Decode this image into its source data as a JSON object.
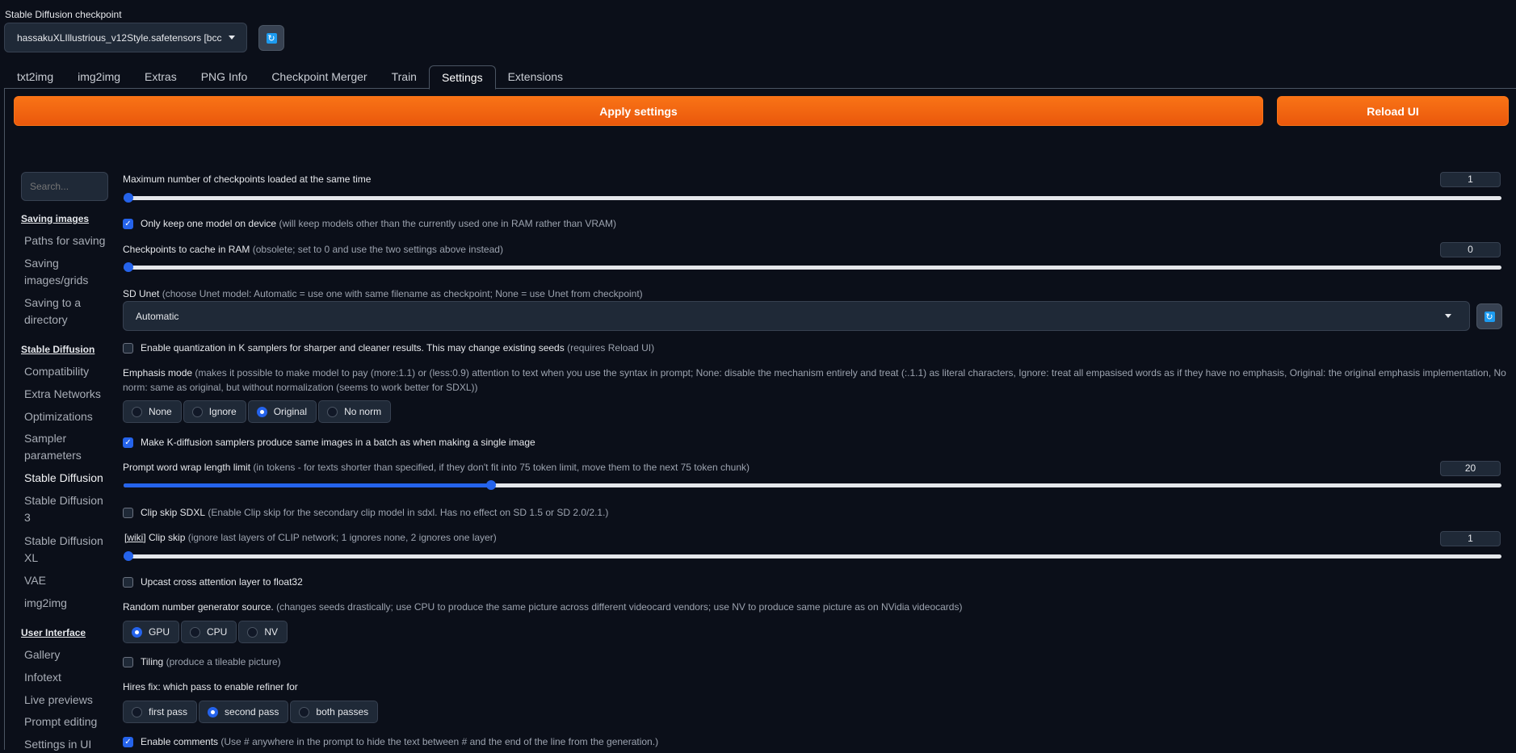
{
  "checkpoint": {
    "label": "Stable Diffusion checkpoint",
    "value": "hassakuXLIllustrious_v12Style.safetensors [bcc:"
  },
  "tabs": [
    "txt2img",
    "img2img",
    "Extras",
    "PNG Info",
    "Checkpoint Merger",
    "Train",
    "Settings",
    "Extensions"
  ],
  "active_tab": "Settings",
  "buttons": {
    "apply": "Apply settings",
    "reload": "Reload UI"
  },
  "sidebar": {
    "search_placeholder": "Search...",
    "sections": [
      {
        "title": "Saving images",
        "items": [
          "Paths for saving",
          "Saving images/grids",
          "Saving to a directory"
        ]
      },
      {
        "title": "Stable Diffusion",
        "items": [
          "Compatibility",
          "Extra Networks",
          "Optimizations",
          "Sampler parameters",
          "Stable Diffusion",
          "Stable Diffusion 3",
          "Stable Diffusion XL",
          "VAE",
          "img2img"
        ]
      },
      {
        "title": "User Interface",
        "items": [
          "Gallery",
          "Infotext",
          "Live previews",
          "Prompt editing",
          "Settings in UI"
        ]
      }
    ],
    "active_item": "Stable Diffusion"
  },
  "settings": {
    "max_checkpoints": {
      "label": "Maximum number of checkpoints loaded at the same time",
      "value": "1",
      "level": 0
    },
    "one_model": {
      "label": "Only keep one model on device",
      "hint": "(will keep models other than the currently used one in RAM rather than VRAM)",
      "checked": true
    },
    "cache_ram": {
      "label": "Checkpoints to cache in RAM",
      "hint": "(obsolete; set to 0 and use the two settings above instead)",
      "value": "0",
      "level": 0
    },
    "sd_unet": {
      "label": "SD Unet",
      "hint": "(choose Unet model: Automatic = use one with same filename as checkpoint; None = use Unet from checkpoint)",
      "value": "Automatic"
    },
    "quantization": {
      "label": "Enable quantization in K samplers for sharper and cleaner results. This may change existing seeds",
      "hint": "(requires Reload UI)",
      "checked": false
    },
    "emphasis": {
      "label": "Emphasis mode",
      "hint_line1": "(makes it possible to make model to pay (more:1.1) or (less:0.9) attention to text when you use the syntax in prompt; None: disable the mechanism entirely and treat (:.1.1) as literal characters, Ignore: treat all empasised words as if they have no emphasis, Original: the original emphasis implementation, No",
      "hint_line2": "norm: same as original, but without normalization (seems to work better for SDXL))",
      "options": [
        "None",
        "Ignore",
        "Original",
        "No norm"
      ],
      "selected": "Original"
    },
    "batch_same": {
      "label": "Make K-diffusion samplers produce same images in a batch as when making a single image",
      "checked": true
    },
    "wrap_limit": {
      "label": "Prompt word wrap length limit",
      "hint": "(in tokens - for texts shorter than specified, if they don't fit into 75 token limit, move them to the next 75 token chunk)",
      "value": "20",
      "level": 0.2667
    },
    "clip_skip_sdxl": {
      "label": "Clip skip SDXL",
      "hint": "(Enable Clip skip for the secondary clip model in sdxl. Has no effect on SD 1.5 or SD 2.0/2.1.)",
      "checked": false
    },
    "clip_skip": {
      "wiki": "[wiki]",
      "label": "Clip skip",
      "hint": "(ignore last layers of CLIP network; 1 ignores none, 2 ignores one layer)",
      "value": "1",
      "level": 0
    },
    "upcast": {
      "label": "Upcast cross attention layer to float32",
      "checked": false
    },
    "rng": {
      "label": "Random number generator source.",
      "hint": "(changes seeds drastically; use CPU to produce the same picture across different videocard vendors; use NV to produce same picture as on NVidia videocards)",
      "options": [
        "GPU",
        "CPU",
        "NV"
      ],
      "selected": "GPU"
    },
    "tiling": {
      "label": "Tiling",
      "hint": "(produce a tileable picture)",
      "checked": false
    },
    "hires_refiner": {
      "label": "Hires fix: which pass to enable refiner for",
      "options": [
        "first pass",
        "second pass",
        "both passes"
      ],
      "selected": "second pass"
    },
    "comments": {
      "label": "Enable comments",
      "hint": "(Use # anywhere in the prompt to hide the text between # and the end of the line from the generation.)",
      "checked": true
    }
  },
  "colors": {
    "accent": "#f97316",
    "slider": "#2563eb",
    "background": "#0b0f19"
  }
}
